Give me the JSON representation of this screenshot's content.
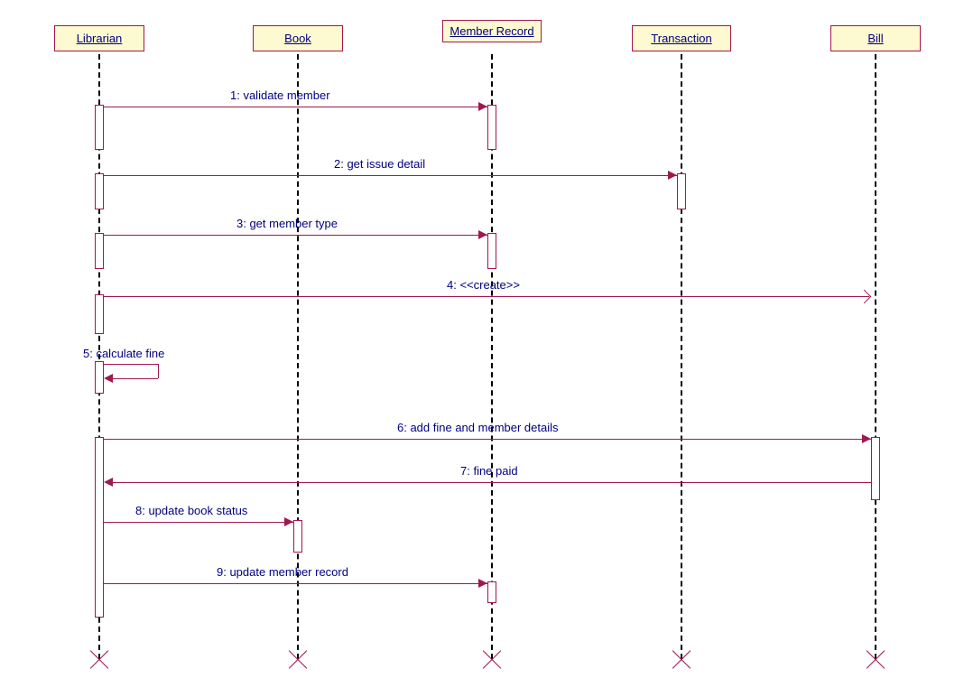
{
  "participants": {
    "librarian": "Librarian",
    "book": "Book",
    "memberRecord": "Member Record",
    "transaction": "Transaction",
    "bill": "Bill"
  },
  "messages": {
    "m1": "1: validate member",
    "m2": "2: get issue detail",
    "m3": "3: get member type",
    "m4": "4: <<create>>",
    "m5": "5: calculate fine",
    "m6": "6: add fine and member details",
    "m7": "7: fine paid",
    "m8": "8: update book status",
    "m9": "9: update member record"
  }
}
